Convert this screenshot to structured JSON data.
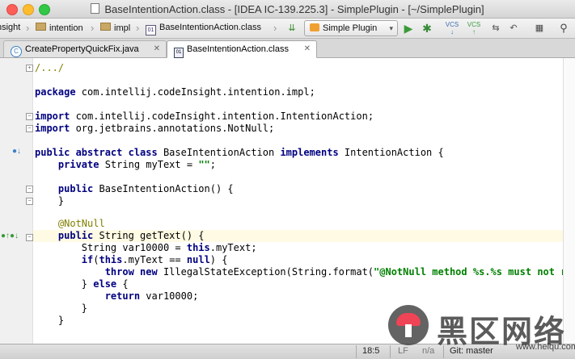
{
  "window": {
    "title": "BaseIntentionAction.class - [IDEA IC-139.225.3] - SimplePlugin - [~/SimplePlugin]"
  },
  "breadcrumbs": [
    "nsight",
    "intention",
    "impl",
    "BaseIntentionAction.class"
  ],
  "toolbar": {
    "run_config": "Simple Plugin"
  },
  "tabs": [
    {
      "label": "CreatePropertyQuickFix.java",
      "active": false
    },
    {
      "label": "BaseIntentionAction.class",
      "active": true
    }
  ],
  "code": {
    "l1": "/.../",
    "l2a": "package",
    "l2b": " com.intellij.codeInsight.intention.impl;",
    "l3a": "import",
    "l3b": " com.intellij.codeInsight.intention.IntentionAction;",
    "l4a": "import",
    "l4b": " org.jetbrains.annotations.NotNull;",
    "l5a": "public abstract class",
    "l5b": " BaseIntentionAction ",
    "l5c": "implements",
    "l5d": " IntentionAction {",
    "l6a": "    private",
    "l6b": " String myText = ",
    "l6c": "\"\"",
    "l6d": ";",
    "l7a": "    public",
    "l7b": " BaseIntentionAction() {",
    "l8": "    }",
    "l9": "    @NotNull",
    "l10a": "    public",
    "l10b": " String getText() {",
    "l11a": "        String var10000 = ",
    "l11b": "this",
    "l11c": ".",
    "l11d": "myText",
    "l11e": ";",
    "l12a": "        if",
    "l12b": "(",
    "l12c": "this",
    "l12d": ".",
    "l12e": "myText",
    "l12f": " == ",
    "l12g": "null",
    "l12h": ") {",
    "l13a": "            throw new",
    "l13b": " IllegalStateException(String.format(",
    "l13c": "\"@NotNull method %s.%s must not retu",
    "l14a": "        } ",
    "l14b": "else",
    "l14c": " {",
    "l15a": "            return",
    "l15b": " var10000;",
    "l16": "        }",
    "l17": "    }"
  },
  "status": {
    "position": "18:5",
    "line_sep": "LF",
    "encoding": "n/a",
    "vcs": "Git: master"
  },
  "watermark": {
    "text": "黑区网络",
    "url": "www.heiqu.com"
  },
  "colors": {
    "keyword": "#000080",
    "string": "#008000",
    "annotation": "#808000",
    "field": "#660e7a",
    "caret_row": "#fffae3"
  }
}
